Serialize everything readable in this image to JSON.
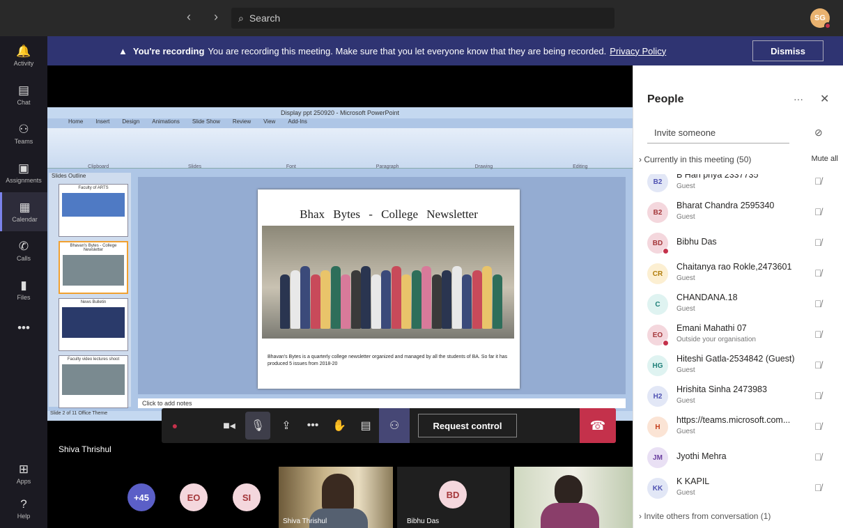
{
  "topbar": {
    "search_placeholder": "Search",
    "avatar_initials": "SG"
  },
  "rail": [
    {
      "label": "Activity",
      "icon": "bell-icon",
      "glyph": "🔔"
    },
    {
      "label": "Chat",
      "icon": "chat-icon",
      "glyph": "▤"
    },
    {
      "label": "Teams",
      "icon": "teams-icon",
      "glyph": "⚇"
    },
    {
      "label": "Assignments",
      "icon": "assignments-icon",
      "glyph": "▣"
    },
    {
      "label": "Calendar",
      "icon": "calendar-icon",
      "glyph": "▦"
    },
    {
      "label": "Calls",
      "icon": "phone-icon",
      "glyph": "✆"
    },
    {
      "label": "Files",
      "icon": "files-icon",
      "glyph": "▮"
    },
    {
      "label": "",
      "icon": "more-icon",
      "glyph": "•••"
    },
    {
      "label": "Apps",
      "icon": "apps-icon",
      "glyph": "⊞"
    },
    {
      "label": "Help",
      "icon": "help-icon",
      "glyph": "?"
    }
  ],
  "banner": {
    "bold": "You're recording",
    "text": "You are recording this meeting. Make sure that you let everyone know that they are being recorded.",
    "link": "Privacy Policy",
    "dismiss": "Dismiss"
  },
  "ppt": {
    "window_title": "Display ppt 250920 - Microsoft PowerPoint",
    "tabs": [
      "Home",
      "Insert",
      "Design",
      "Animations",
      "Slide Show",
      "Review",
      "View",
      "Add-Ins"
    ],
    "groups": [
      "Clipboard",
      "Slides",
      "Font",
      "Paragraph",
      "Drawing",
      "Editing"
    ],
    "pane_tabs": "Slides  Outline",
    "thumbs": [
      "Faculty of ARTS",
      "Bhavan's Bytes - College Newsletter",
      "News Bulletin",
      "Faculty video lectures shoot"
    ],
    "slide_title": "Bhax Bytes - College Newsletter",
    "slide_text": "Bhavan's Bytes is a quarterly college newsletter organized and managed by all the students of BA. So far it has produced 5 issues from 2018-20",
    "notes": "Click to add notes",
    "status": "Slide 2 of 11   Office Theme"
  },
  "controls": {
    "request_control": "Request control"
  },
  "presenter": "Shiva Thrishul",
  "strip": {
    "more_count": "+45",
    "circles": [
      {
        "initials": "EO",
        "bg": "#f4d7dd",
        "fg": "#a4373a"
      },
      {
        "initials": "SI",
        "bg": "#f4d7dd",
        "fg": "#a4373a"
      }
    ],
    "tile1_name": "Shiva Thrishul",
    "tile2_initials": "BD",
    "tile2_name": "Bibhu Das"
  },
  "people": {
    "title": "People",
    "invite_placeholder": "Invite someone",
    "section": "Currently in this meeting (50)",
    "mute_all": "Mute all",
    "invite_others": "Invite others from conversation (1)",
    "list": [
      {
        "initials": "B2",
        "name": "B Hari priya 2337735",
        "sub": "Guest",
        "bg": "#e2e7f6",
        "fg": "#4f52b2",
        "dot": false
      },
      {
        "initials": "B2",
        "name": "Bharat Chandra 2595340",
        "sub": "Guest",
        "bg": "#f4d7dd",
        "fg": "#a4373a",
        "dot": false
      },
      {
        "initials": "BD",
        "name": "Bibhu Das",
        "sub": "",
        "bg": "#f4d7dd",
        "fg": "#a4373a",
        "dot": true
      },
      {
        "initials": "CR",
        "name": "Chaitanya rao Rokle,2473601",
        "sub": "Guest",
        "bg": "#fcefd2",
        "fg": "#b07c0a",
        "dot": false
      },
      {
        "initials": "C",
        "name": "CHANDANA.18",
        "sub": "Guest",
        "bg": "#dff3f1",
        "fg": "#1e7f78",
        "dot": false
      },
      {
        "initials": "EO",
        "name": "Emani Mahathi 07",
        "sub": "Outside your organisation",
        "bg": "#f4d7dd",
        "fg": "#a4373a",
        "dot": true
      },
      {
        "initials": "HG",
        "name": "Hiteshi Gatla-2534842 (Guest)",
        "sub": "Guest",
        "bg": "#dff3f1",
        "fg": "#1e7f78",
        "dot": false
      },
      {
        "initials": "H2",
        "name": "Hrishita Sinha 2473983",
        "sub": "Guest",
        "bg": "#e2e7f6",
        "fg": "#4f52b2",
        "dot": false
      },
      {
        "initials": "H",
        "name": "https://teams.microsoft.com...",
        "sub": "Guest",
        "bg": "#fbe4d5",
        "fg": "#c43e1c",
        "dot": false
      },
      {
        "initials": "JM",
        "name": "Jyothi Mehra",
        "sub": "",
        "bg": "#e9e0f4",
        "fg": "#6b3fa0",
        "dot": false
      },
      {
        "initials": "KK",
        "name": "K KAPIL",
        "sub": "Guest",
        "bg": "#e2e7f6",
        "fg": "#4f52b2",
        "dot": false
      }
    ]
  }
}
